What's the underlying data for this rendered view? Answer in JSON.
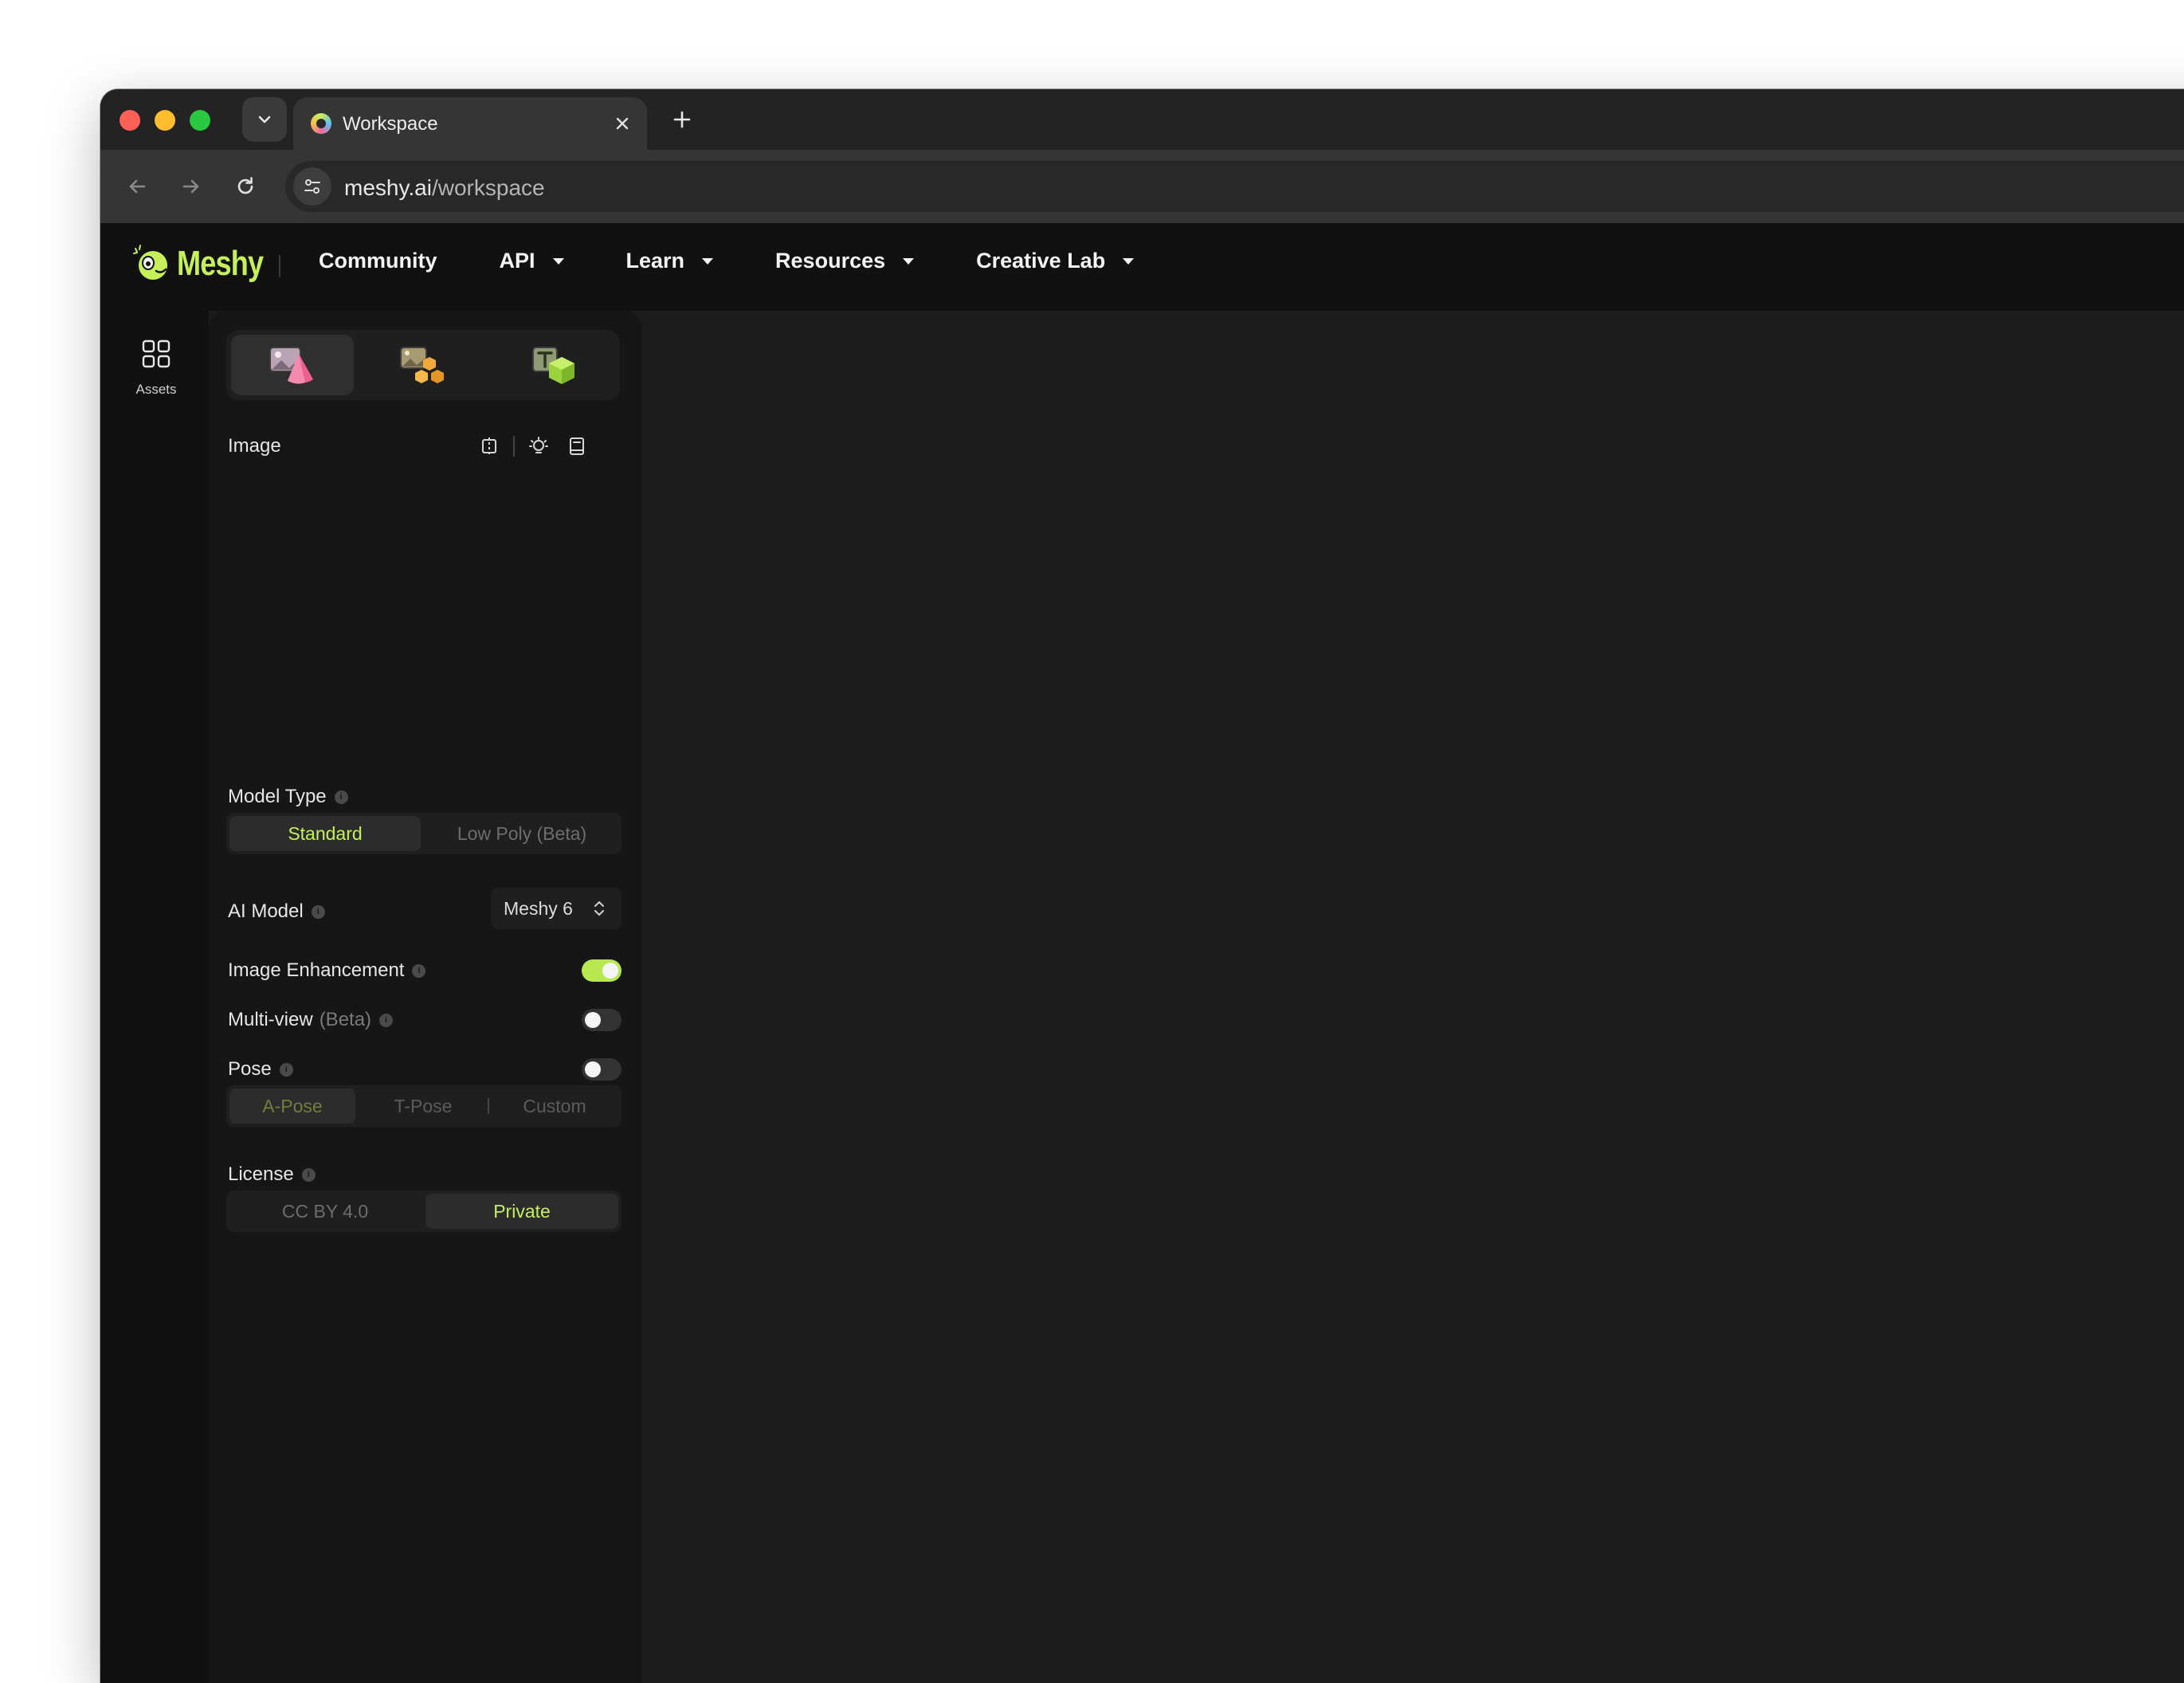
{
  "browser": {
    "tab_title": "Workspace",
    "url_host": "meshy.ai",
    "url_path": "/workspace"
  },
  "header": {
    "logo_text": "Meshy",
    "nav": [
      {
        "label": "Community",
        "has_dropdown": false
      },
      {
        "label": "API",
        "has_dropdown": true
      },
      {
        "label": "Learn",
        "has_dropdown": true
      },
      {
        "label": "Resources",
        "has_dropdown": true
      },
      {
        "label": "Creative Lab",
        "has_dropdown": true
      }
    ]
  },
  "rail": {
    "assets_label": "Assets",
    "assets_icon": "grid-icon"
  },
  "panel": {
    "mode_tabs": [
      {
        "icon": "image-to-3d-icon",
        "active": true
      },
      {
        "icon": "multi-image-to-3d-icon",
        "active": false
      },
      {
        "icon": "text-to-3d-icon",
        "active": false
      }
    ],
    "image_label": "Image",
    "image_tools": [
      "crop-icon",
      "lightbulb-icon",
      "book-icon"
    ],
    "model_type": {
      "label": "Model Type",
      "options": [
        "Standard",
        "Low Poly (Beta)"
      ],
      "selected": "Standard"
    },
    "ai_model": {
      "label": "AI Model",
      "value": "Meshy 6"
    },
    "image_enhancement": {
      "label": "Image Enhancement",
      "enabled": true
    },
    "multi_view": {
      "label": "Multi-view",
      "suffix": "(Beta)",
      "enabled": false
    },
    "pose": {
      "label": "Pose",
      "enabled": false,
      "options": [
        "A-Pose",
        "T-Pose",
        "Custom"
      ],
      "selected": "A-Pose"
    },
    "license": {
      "label": "License",
      "options": [
        "CC BY 4.0",
        "Private"
      ],
      "selected": "Private"
    }
  },
  "colors": {
    "accent": "#c5f05a",
    "background": "#1c1c1c",
    "panel": "#161616"
  }
}
